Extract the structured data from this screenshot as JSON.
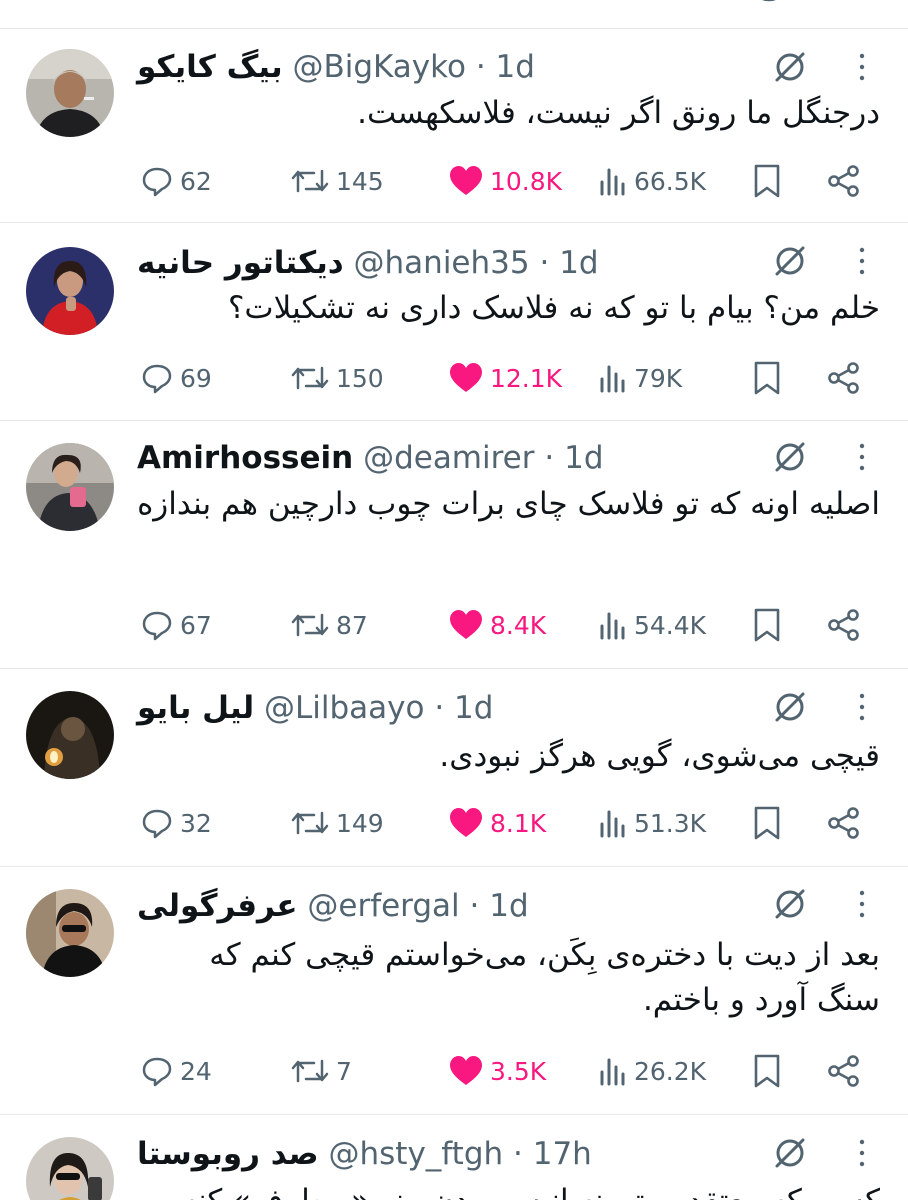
{
  "colors": {
    "text": "#0f1419",
    "muted": "#536471",
    "like": "#f91880",
    "divider": "#e6e9eb"
  },
  "icons": [
    "reply-icon",
    "retweet-icon",
    "heart-icon",
    "views-icon",
    "bookmark-icon",
    "share-icon",
    "grok-icon",
    "more-icon"
  ],
  "tweets": [
    {
      "name": "بیگ کایکو",
      "handle": "@BigKayko",
      "dot": "·",
      "time": "1d",
      "text": "درجنگل ما رونق اگر نیست، فلاسکهست.",
      "replies": "62",
      "retweets": "145",
      "likes": "10.8K",
      "views": "66.5K",
      "liked": true
    },
    {
      "name": "دیکتاتور حانیه",
      "handle": "@hanieh35",
      "dot": "·",
      "time": "1d",
      "text": "خلم من؟ بیام با تو که نه فلاسک داری نه تشکیلات؟",
      "replies": "69",
      "retweets": "150",
      "likes": "12.1K",
      "views": "79K",
      "liked": true
    },
    {
      "name": "Amirhossein",
      "handle": "@deamirer",
      "dot": "·",
      "time": "1d",
      "text": "اصلیه اونه که تو فلاسک چای برات چوب دارچین هم بندازه",
      "replies": "67",
      "retweets": "87",
      "likes": "8.4K",
      "views": "54.4K",
      "liked": true
    },
    {
      "name": "لیل بایو",
      "handle": "@Lilbaayo",
      "dot": "·",
      "time": "1d",
      "text": "قیچی می‌شوی، گویی هرگز نبودی.",
      "replies": "32",
      "retweets": "149",
      "likes": "8.1K",
      "views": "51.3K",
      "liked": true
    },
    {
      "name": "عرفرگولی",
      "handle": "@erfergal",
      "dot": "·",
      "time": "1d",
      "text": "بعد از دیت با دختره‌ی بِکَن، می‌خواستم قیچی کنم که سنگ آورد و باختم.",
      "replies": "24",
      "retweets": "7",
      "likes": "3.5K",
      "views": "26.2K",
      "liked": true
    },
    {
      "name": "صد روبوستا",
      "handle": "@hsty_ftgh",
      "dot": "·",
      "time": "17h",
      "text": "کسی که معتقده مترونه انیس بودن منو «برطرف» کنه",
      "replies": "",
      "retweets": "",
      "likes": "",
      "views": "",
      "liked": false
    }
  ]
}
